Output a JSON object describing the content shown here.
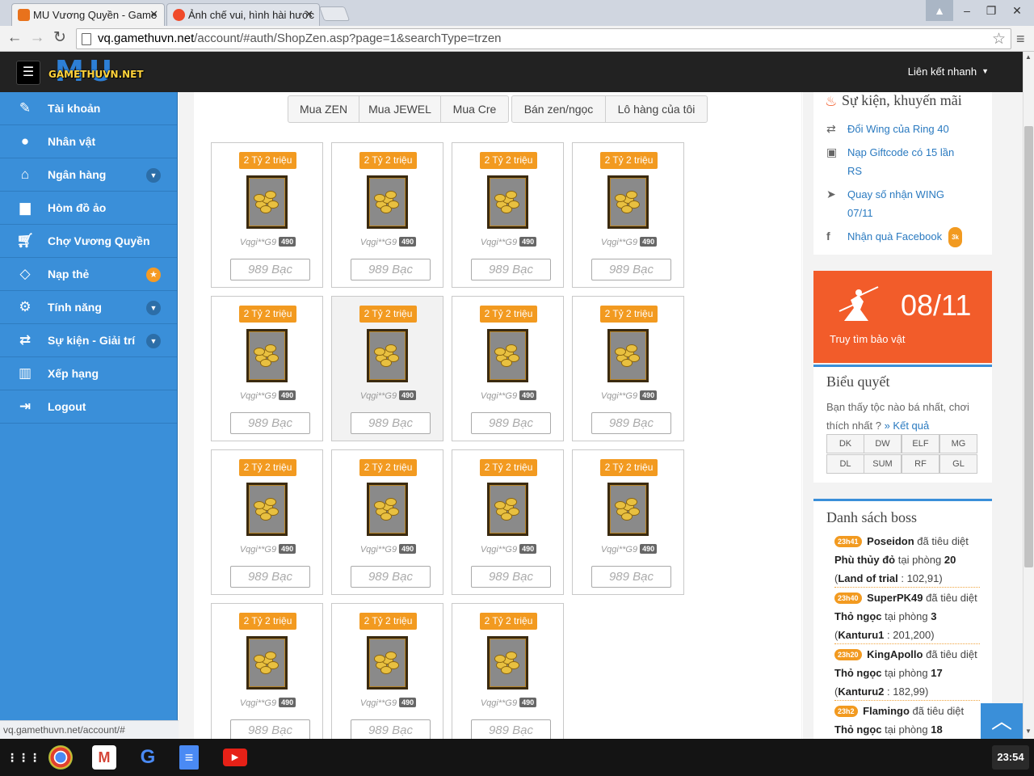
{
  "browser": {
    "tabs": [
      {
        "title": "MU Vương Quyền - Game"
      },
      {
        "title": "Ảnh chế vui, hình hài hước"
      }
    ],
    "url_host": "vq.gamethuvn.net",
    "url_path": "/account/#auth/ShopZen.asp?page=1&searchType=trzen",
    "status_url": "vq.gamethuvn.net/account/#"
  },
  "header": {
    "logo_back": "MU",
    "logo_text": "GAMETHUVN.NET",
    "quick_link": "Liên kết nhanh"
  },
  "sidebar": {
    "items": [
      {
        "label": "Tài khoản",
        "icon": "edit-icon"
      },
      {
        "label": "Nhân vật",
        "icon": "user-icon"
      },
      {
        "label": "Ngân hàng",
        "icon": "bank-icon"
      },
      {
        "label": "Hòm đồ ảo",
        "icon": "briefcase-icon"
      },
      {
        "label": "Chợ Vương Quyền",
        "icon": "cart-icon"
      },
      {
        "label": "Nạp thẻ",
        "icon": "diamond-icon"
      },
      {
        "label": "Tính năng",
        "icon": "gears-icon"
      },
      {
        "label": "Sự kiện - Giải trí",
        "icon": "exchange-icon"
      },
      {
        "label": "Xếp hạng",
        "icon": "chart-icon"
      },
      {
        "label": "Logout",
        "icon": "logout-icon"
      }
    ]
  },
  "shop_tabs": [
    "Mua ZEN",
    "Mua JEWEL",
    "Mua Cre",
    "Bán zen/ngọc",
    "Lô hàng của tôi"
  ],
  "item": {
    "price_badge": "2 Tỷ 2 triệu",
    "seller": "Vqgi**G9",
    "level": "490",
    "cost": "989 Bạc"
  },
  "events": {
    "title": "Sự kiện, khuyến mãi",
    "items": [
      {
        "text": "Đổi Wing của Ring 40",
        "icon": "exchange-icon"
      },
      {
        "text": "Nạp Giftcode có 15 lần RS",
        "icon": "gift-icon"
      },
      {
        "text": "Quay số nhận WING 07/11",
        "icon": "send-icon"
      },
      {
        "text": "Nhận quà Facebook",
        "icon": "facebook-icon",
        "count": "3k"
      }
    ]
  },
  "promo": {
    "date": "08/11",
    "text": "Truy tìm bảo vật"
  },
  "poll": {
    "title": "Biểu quyết",
    "question": "Bạn thấy tộc nào bá nhất, chơi thích nhất ?",
    "result_link": "» Kết quả",
    "options": [
      "DK",
      "DW",
      "ELF",
      "MG",
      "DL",
      "SUM",
      "RF",
      "GL"
    ]
  },
  "bosses": {
    "title": "Danh sách boss",
    "verb": "đã tiêu diệt",
    "at_room": "tại phòng",
    "entries": [
      {
        "time": "23h41",
        "player": "Poseidon",
        "boss": "Phù thủy đỏ",
        "room": "20",
        "map": "Land of trial",
        "coords": "102,91"
      },
      {
        "time": "23h40",
        "player": "SuperPK49",
        "boss": "Thỏ ngọc",
        "room": "3",
        "map": "Kanturu1",
        "coords": "201,200"
      },
      {
        "time": "23h20",
        "player": "KingApollo",
        "boss": "Thỏ ngọc",
        "room": "17",
        "map": "Kanturu2",
        "coords": "182,99"
      },
      {
        "time": "23h2",
        "player": "Flamingo",
        "boss": "Thỏ ngọc",
        "room": "18"
      }
    ]
  },
  "taskbar": {
    "clock": "23:54"
  }
}
